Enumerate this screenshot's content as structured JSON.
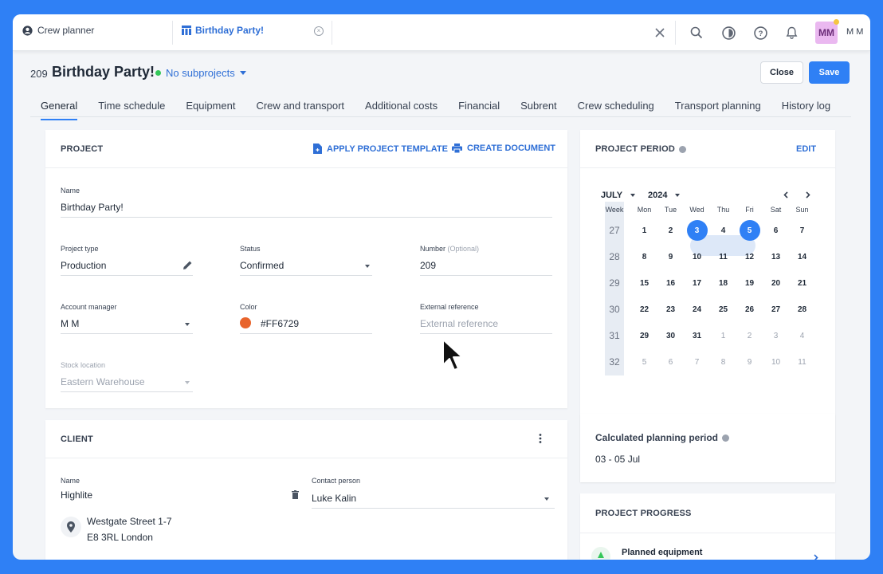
{
  "topbar": {
    "tab_planner": "Crew planner",
    "tab_project": "Birthday Party!",
    "avatar_initials": "MM",
    "user_name": "M M",
    "icons": [
      "close-icon",
      "search-icon",
      "theme-icon",
      "help-icon",
      "bell-icon"
    ]
  },
  "header": {
    "project_number": "209",
    "project_title": "Birthday Party!",
    "subprojects": "No subprojects",
    "close_label": "Close",
    "save_label": "Save"
  },
  "nav": {
    "tabs": [
      "General",
      "Time schedule",
      "Equipment",
      "Crew and transport",
      "Additional costs",
      "Financial",
      "Subrent",
      "Crew scheduling",
      "Transport planning",
      "History log"
    ]
  },
  "project": {
    "title": "PROJECT",
    "apply_template": "APPLY PROJECT TEMPLATE",
    "create_document": "CREATE DOCUMENT",
    "name_label": "Name",
    "name_value": "Birthday Party!",
    "type_label": "Project type",
    "type_value": "Production",
    "status_label": "Status",
    "status_value": "Confirmed",
    "number_label": "Number",
    "number_optional": "(Optional)",
    "number_value": "209",
    "manager_label": "Account manager",
    "manager_value": "M M",
    "color_label": "Color",
    "color_value": "#FF6729",
    "color_hex": "#e8642c",
    "extref_label": "External reference",
    "extref_placeholder": "External reference",
    "stock_label": "Stock location",
    "stock_value": "Eastern Warehouse"
  },
  "client": {
    "title": "CLIENT",
    "name_label": "Name",
    "name_value": "Highlite",
    "contact_label": "Contact person",
    "contact_value": "Luke Kalin",
    "address_line1": "Westgate Street 1-7",
    "address_line2": "E8 3RL London"
  },
  "period": {
    "title": "PROJECT PERIOD",
    "edit": "EDIT",
    "month": "JULY",
    "year": "2024",
    "weekdays": [
      "Week",
      "Mon",
      "Tue",
      "Wed",
      "Thu",
      "Fri",
      "Sat",
      "Sun"
    ],
    "weeks": [
      {
        "week": "27",
        "days": [
          "1",
          "2",
          "3",
          "4",
          "5",
          "6",
          "7"
        ]
      },
      {
        "week": "28",
        "days": [
          "8",
          "9",
          "10",
          "11",
          "12",
          "13",
          "14"
        ]
      },
      {
        "week": "29",
        "days": [
          "15",
          "16",
          "17",
          "18",
          "19",
          "20",
          "21"
        ]
      },
      {
        "week": "30",
        "days": [
          "22",
          "23",
          "24",
          "25",
          "26",
          "27",
          "28"
        ]
      },
      {
        "week": "31",
        "days": [
          "29",
          "30",
          "31",
          "1",
          "2",
          "3",
          "4"
        ]
      },
      {
        "week": "32",
        "days": [
          "5",
          "6",
          "7",
          "8",
          "9",
          "10",
          "11"
        ]
      }
    ],
    "calc_title": "Calculated planning period",
    "calc_value": "03 - 05 Jul"
  },
  "progress": {
    "title": "PROJECT PROGRESS",
    "item1": "Planned equipment"
  }
}
